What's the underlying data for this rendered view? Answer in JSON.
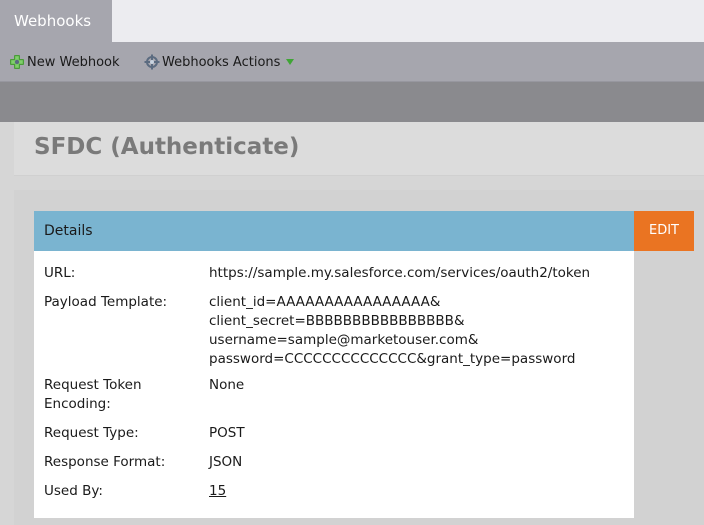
{
  "tabs": [
    {
      "label": "Webhooks",
      "active": true
    }
  ],
  "toolbar": {
    "new_webhook": "New Webhook",
    "webhooks_actions": "Webhooks Actions"
  },
  "page": {
    "title": "SFDC (Authenticate)"
  },
  "details": {
    "header": "Details",
    "edit_label": "EDIT",
    "rows": {
      "url": {
        "label": "URL:",
        "value": "https://sample.my.salesforce.com/services/oauth2/token"
      },
      "payload": {
        "label": "Payload Template:",
        "lines": [
          "client_id=AAAAAAAAAAAAAAAA&",
          "client_secret=BBBBBBBBBBBBBBBB&",
          "username=sample@marketouser.com&",
          "password=CCCCCCCCCCCCCC&grant_type=password"
        ]
      },
      "token_encoding": {
        "label_lines": [
          "Request Token",
          "Encoding:"
        ],
        "value": "None"
      },
      "request_type": {
        "label": "Request Type:",
        "value": "POST"
      },
      "response_format": {
        "label": "Response Format:",
        "value": "JSON"
      },
      "used_by": {
        "label": "Used By:",
        "value": "15"
      }
    }
  },
  "colors": {
    "accent_edit": "#ea7422",
    "details_header": "#7ab4d0",
    "toolbar": "#a6a6ae"
  },
  "icons": {
    "new_webhook": "add-webhook-icon",
    "webhooks_actions": "webhook-actions-icon",
    "dropdown": "caret-down-icon"
  }
}
